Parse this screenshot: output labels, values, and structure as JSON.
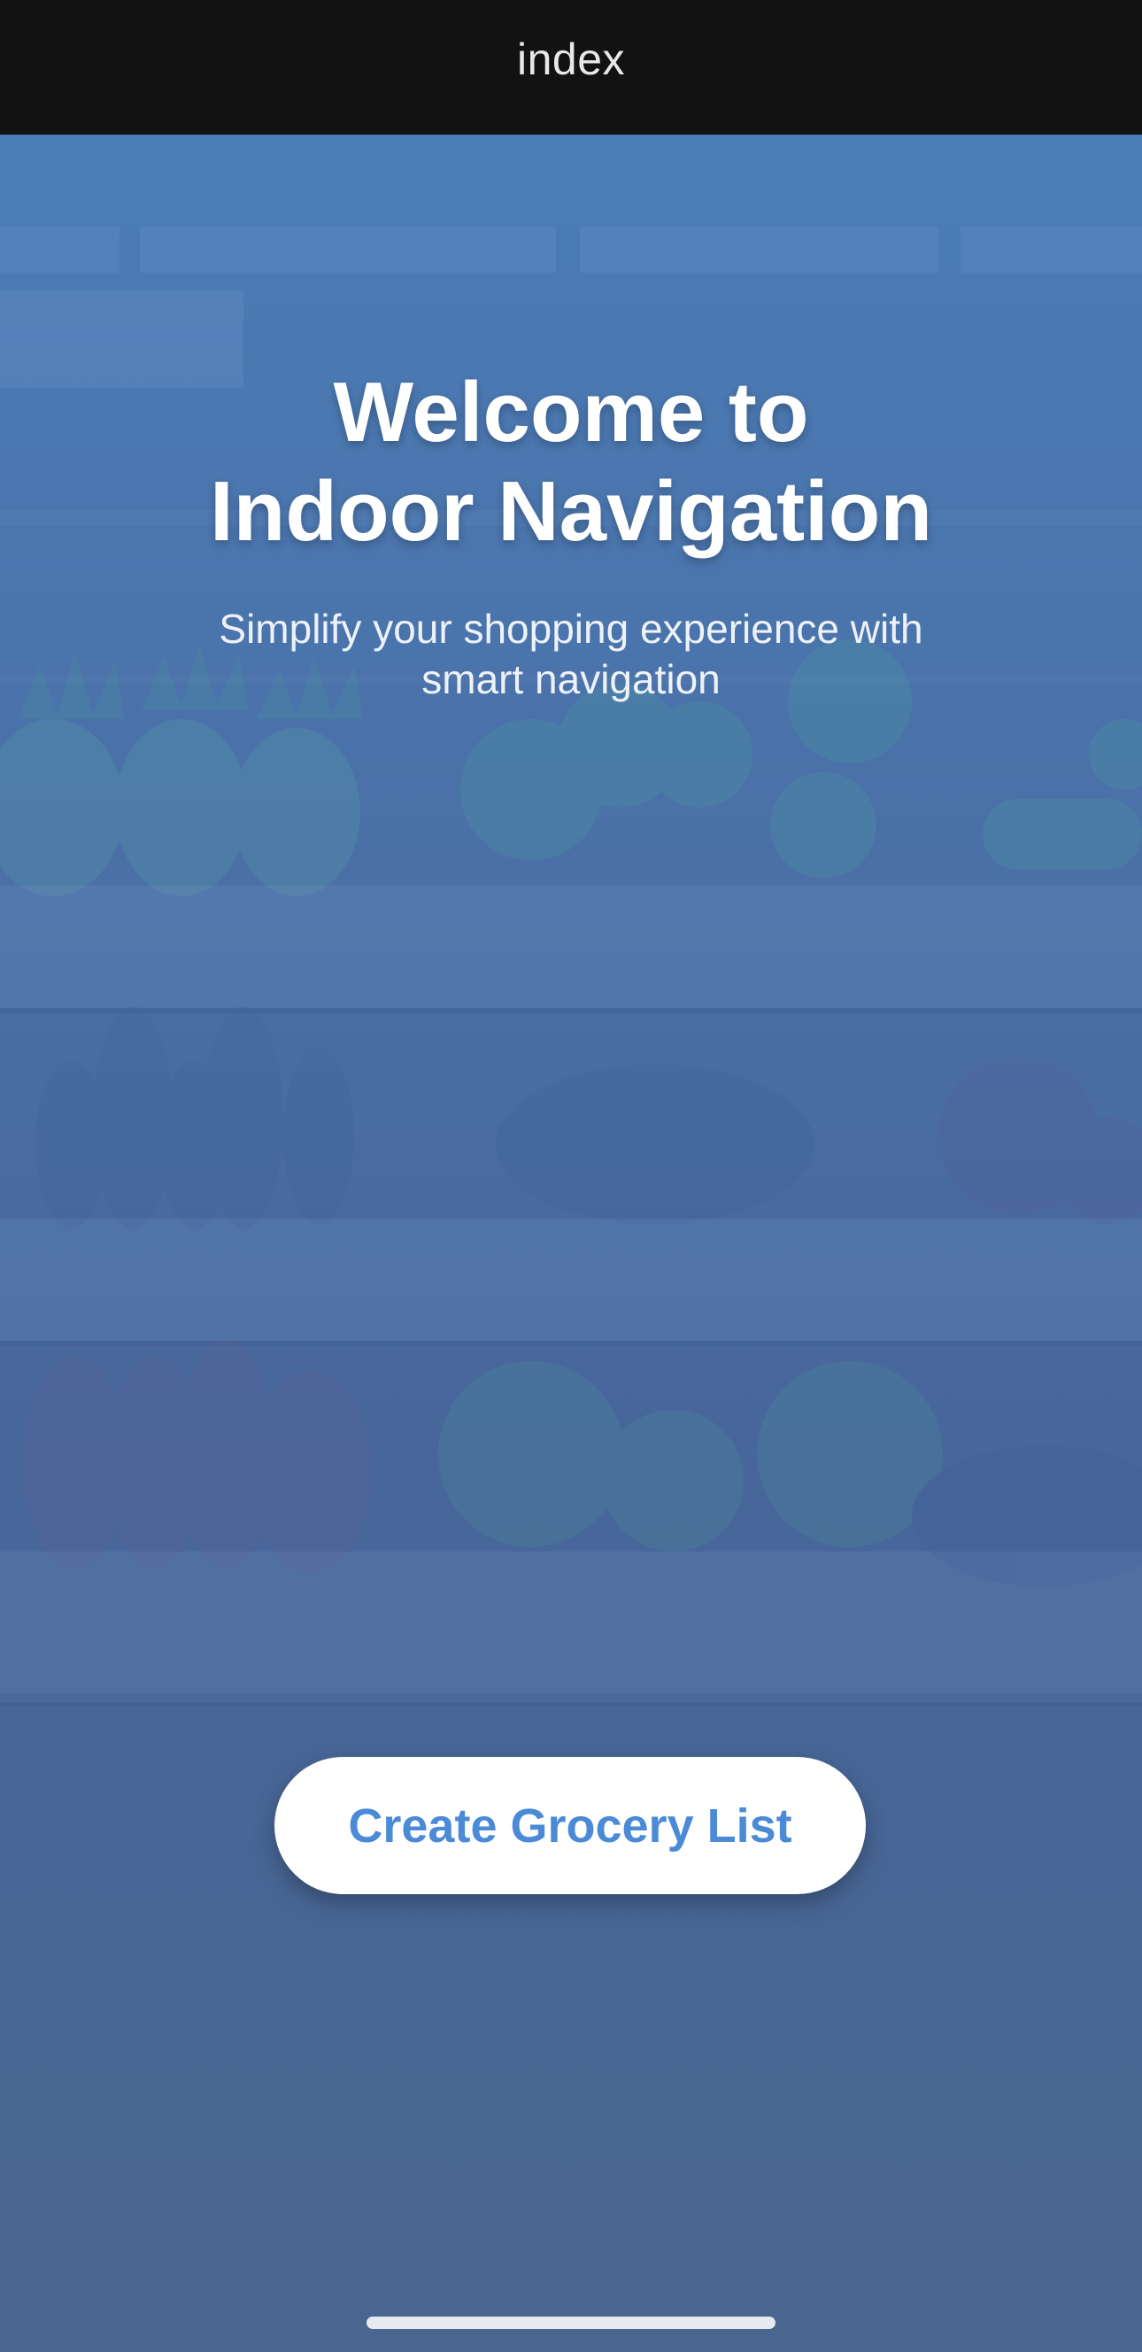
{
  "nav": {
    "title": "index"
  },
  "hero": {
    "title_line1": "Welcome to",
    "title_line2": "Indoor Navigation",
    "subtitle_line1": "Simplify your shopping experience with",
    "subtitle_line2": "smart navigation"
  },
  "cta": {
    "label": "Create Grocery List"
  },
  "colors": {
    "background_top": "#4b7db7",
    "background_bottom": "#48668f",
    "button_text": "#4a8ad6",
    "button_bg": "#ffffff",
    "nav_bg": "#121212"
  }
}
